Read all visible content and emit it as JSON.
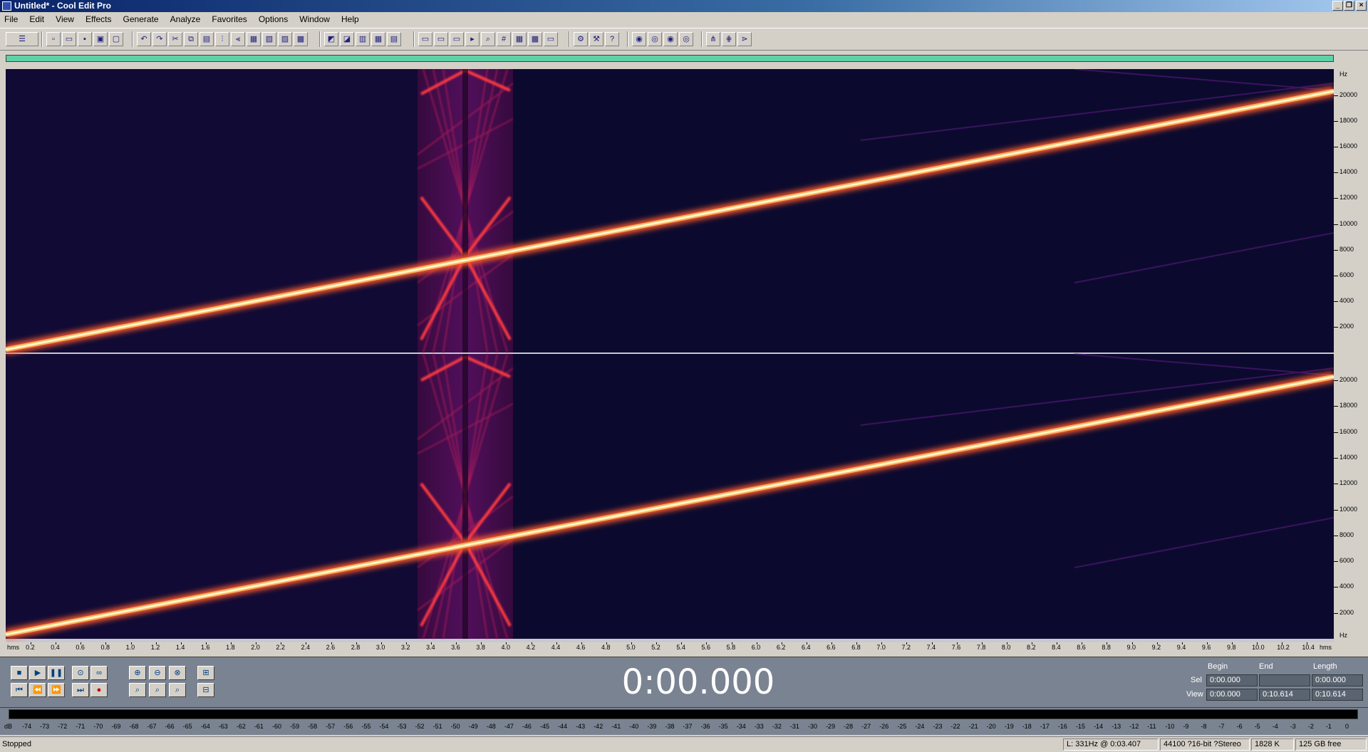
{
  "window": {
    "title": "Untitled* - Cool Edit Pro"
  },
  "menu": [
    "File",
    "Edit",
    "View",
    "Effects",
    "Generate",
    "Analyze",
    "Favorites",
    "Options",
    "Window",
    "Help"
  ],
  "frequency_axis": {
    "unit": "Hz",
    "ticks": [
      "20000",
      "18000",
      "16000",
      "14000",
      "12000",
      "10000",
      "8000",
      "6000",
      "4000",
      "2000"
    ]
  },
  "time_axis": {
    "start_label": "hms",
    "end_label": "hms",
    "ticks": [
      "0.2",
      "0.4",
      "0.6",
      "0.8",
      "1.0",
      "1.2",
      "1.4",
      "1.6",
      "1.8",
      "2.0",
      "2.2",
      "2.4",
      "2.6",
      "2.8",
      "3.0",
      "3.2",
      "3.4",
      "3.6",
      "3.8",
      "4.0",
      "4.2",
      "4.4",
      "4.6",
      "4.8",
      "5.0",
      "5.2",
      "5.4",
      "5.6",
      "5.8",
      "6.0",
      "6.2",
      "6.4",
      "6.6",
      "6.8",
      "7.0",
      "7.2",
      "7.4",
      "7.6",
      "7.8",
      "8.0",
      "8.2",
      "8.4",
      "8.6",
      "8.8",
      "9.0",
      "9.2",
      "9.4",
      "9.6",
      "9.8",
      "10.0",
      "10.2",
      "10.4"
    ]
  },
  "transport": {
    "time": "0:00.000"
  },
  "selection": {
    "headers": {
      "begin": "Begin",
      "end": "End",
      "length": "Length"
    },
    "sel": {
      "label": "Sel",
      "begin": "0:00.000",
      "end": "",
      "length": "0:00.000"
    },
    "view": {
      "label": "View",
      "begin": "0:00.000",
      "end": "0:10.614",
      "length": "0:10.614"
    }
  },
  "level_meter": {
    "ticks": [
      "dB",
      "-74",
      "-73",
      "-72",
      "-71",
      "-70",
      "-69",
      "-68",
      "-67",
      "-66",
      "-65",
      "-64",
      "-63",
      "-62",
      "-61",
      "-60",
      "-59",
      "-58",
      "-57",
      "-56",
      "-55",
      "-54",
      "-53",
      "-52",
      "-51",
      "-50",
      "-49",
      "-48",
      "-47",
      "-46",
      "-45",
      "-44",
      "-43",
      "-42",
      "-41",
      "-40",
      "-39",
      "-38",
      "-37",
      "-36",
      "-35",
      "-34",
      "-33",
      "-32",
      "-31",
      "-30",
      "-29",
      "-28",
      "-27",
      "-26",
      "-25",
      "-24",
      "-23",
      "-22",
      "-21",
      "-20",
      "-19",
      "-18",
      "-17",
      "-16",
      "-15",
      "-14",
      "-13",
      "-12",
      "-11",
      "-10",
      "-9",
      "-8",
      "-7",
      "-6",
      "-5",
      "-4",
      "-3",
      "-2",
      "-1",
      "0"
    ]
  },
  "status": {
    "state": "Stopped",
    "cursor": "L: 331Hz @  0:03.407",
    "format": "44100 ?16-bit ?Stereo",
    "size": "1828 K",
    "free": "125 GB free"
  },
  "colors": {
    "spectrogram_bg": "#0b0a2e",
    "sweep_core": "#fff8c8",
    "sweep_glow": "#ff5a2a",
    "burst": "#d0205a",
    "overview": "#5fd0a8"
  }
}
